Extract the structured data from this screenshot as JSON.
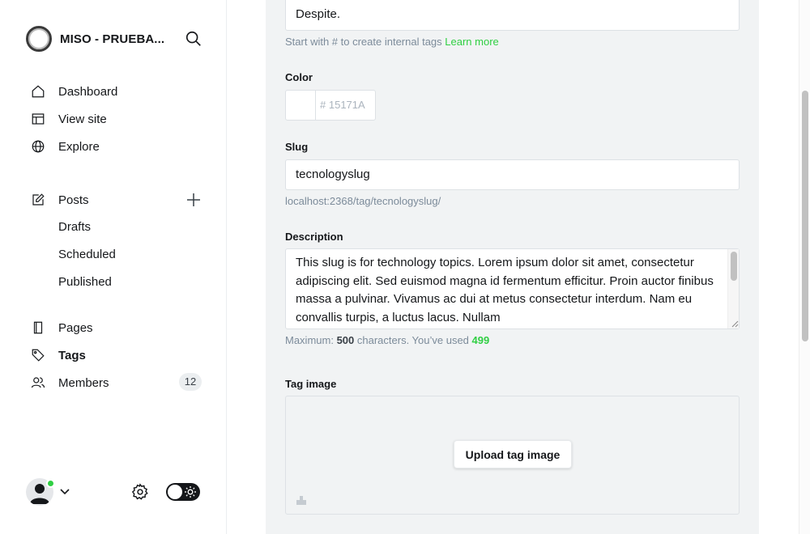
{
  "sidebar": {
    "site_name": "MISO - PRUEBA...",
    "nav": {
      "dashboard": "Dashboard",
      "view_site": "View site",
      "explore": "Explore",
      "posts": "Posts",
      "drafts": "Drafts",
      "scheduled": "Scheduled",
      "published": "Published",
      "pages": "Pages",
      "tags": "Tags",
      "members": "Members",
      "members_count": "12"
    },
    "icons": [
      "search-icon",
      "home-icon",
      "layout-icon",
      "globe-icon",
      "pencil-square-icon",
      "plus-icon",
      "pages-icon",
      "tag-icon",
      "members-icon",
      "gear-icon",
      "sun-icon"
    ]
  },
  "form": {
    "name_value": "Despite.",
    "name_hint_prefix": "Start with # to create internal tags ",
    "name_hint_link": "Learn more",
    "color_label": "Color",
    "color_hash": "#",
    "color_value": "15171A",
    "slug_label": "Slug",
    "slug_value": "tecnologyslug",
    "slug_hint": "localhost:2368/tag/tecnologyslug/",
    "description_label": "Description",
    "description_value": "This slug is for technology topics. Lorem ipsum dolor sit amet, consectetur adipiscing elit. Sed euismod magna id fermentum efficitur. Proin auctor finibus massa a pulvinar. Vivamus ac dui at metus consectetur interdum. Nam eu convallis turpis, a luctus lacus. Nullam",
    "description_hint_prefix": "Maximum: ",
    "description_max": "500",
    "description_hint_mid": " characters. You’ve used ",
    "description_used": "499",
    "tag_image_label": "Tag image",
    "upload_button": "Upload tag image"
  },
  "colors": {
    "accent_green": "#30cf43",
    "text_dark": "#15171a",
    "panel_bg": "#f1f3f4"
  }
}
